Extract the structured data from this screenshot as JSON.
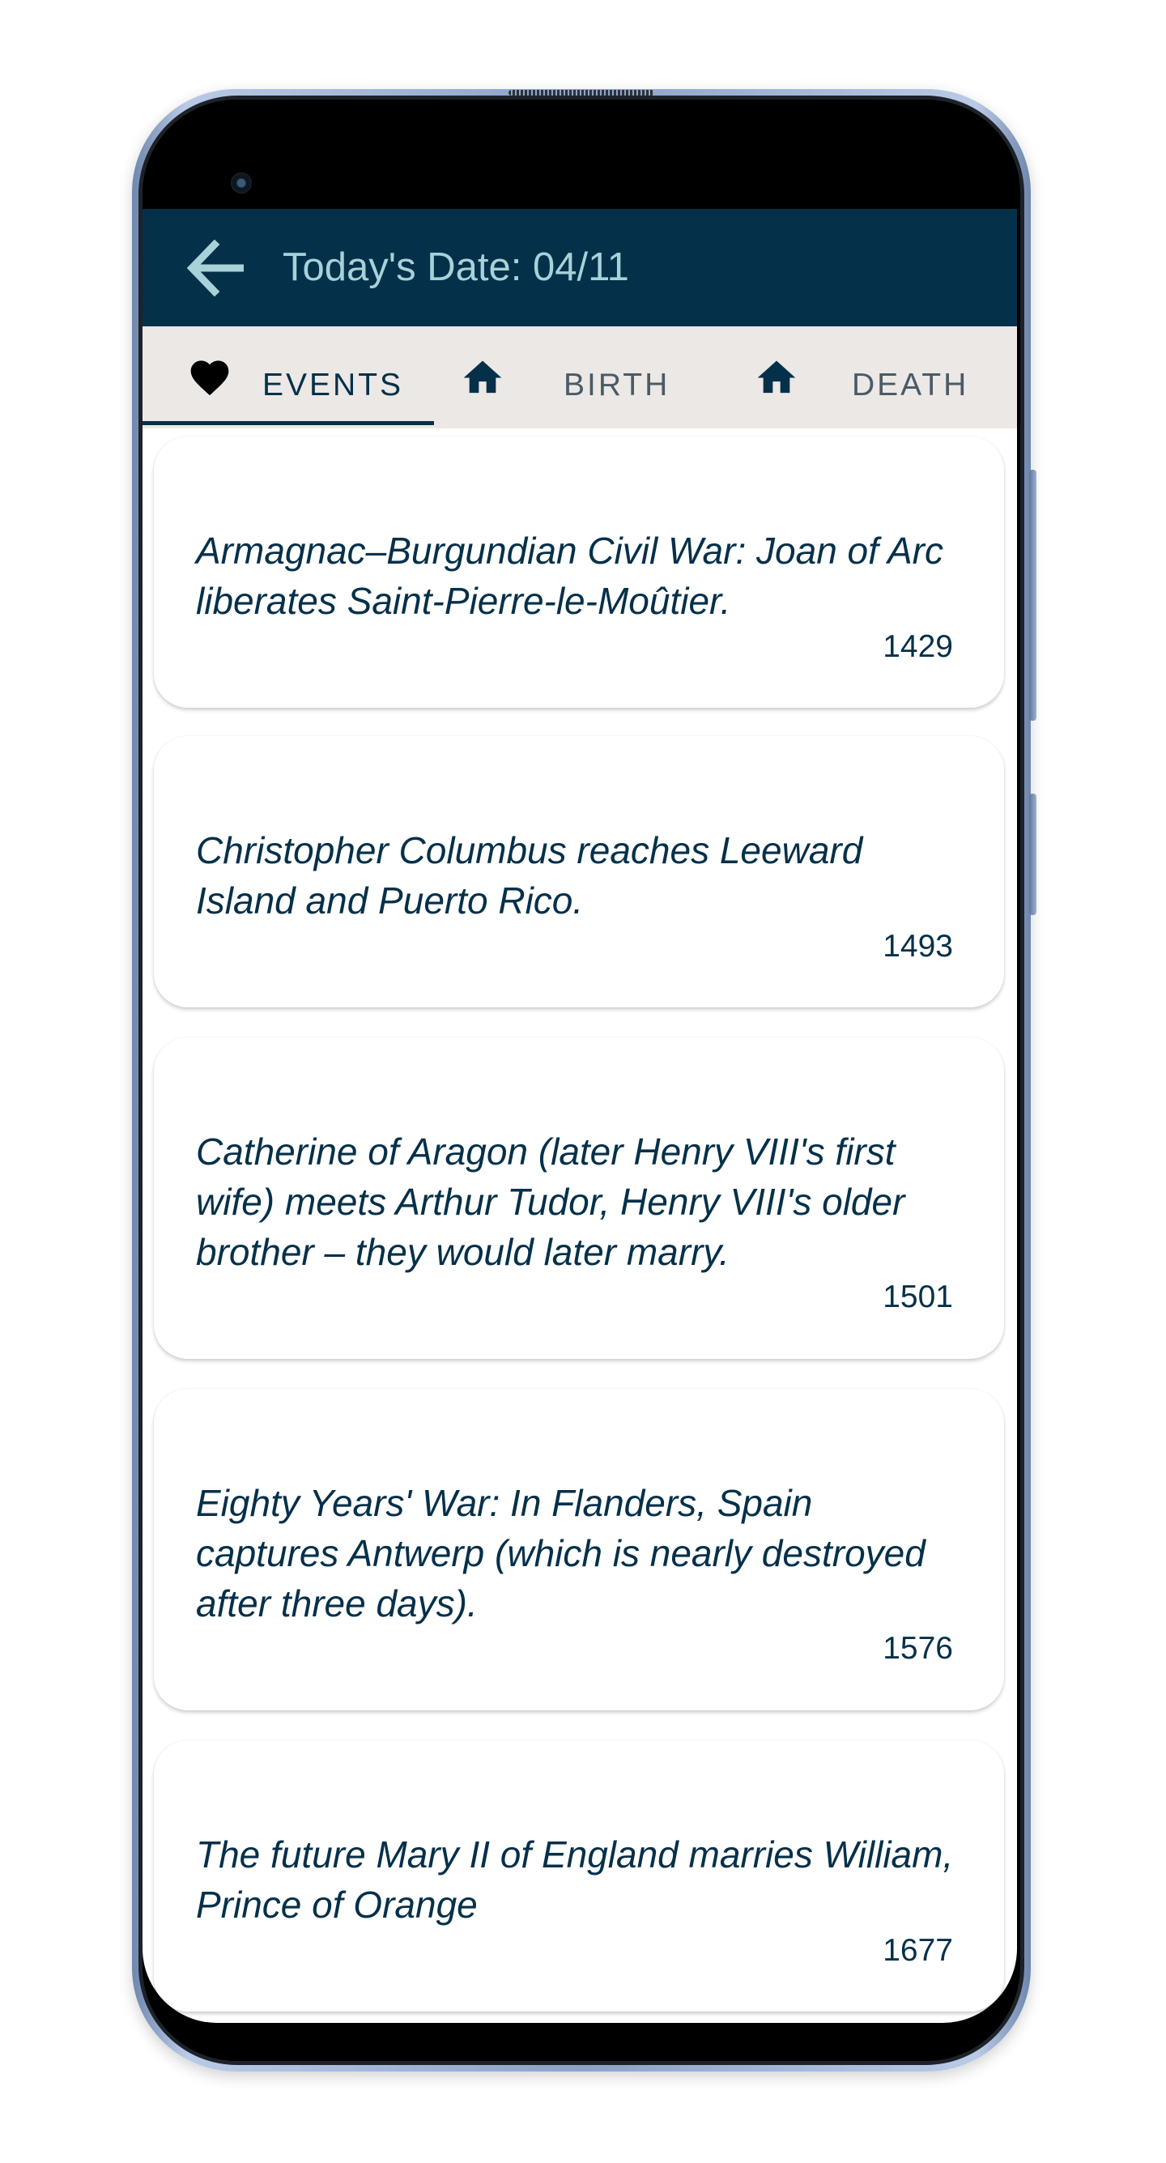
{
  "app_bar": {
    "back_icon": "arrow-left-icon",
    "title": "Today's Date: 04/11"
  },
  "tabs": [
    {
      "label": "EVENTS",
      "icon": "heart-icon",
      "active": true
    },
    {
      "label": "BIRTH",
      "icon": "home-icon",
      "active": false
    },
    {
      "label": "DEATH",
      "icon": "home-icon",
      "active": false
    }
  ],
  "events": [
    {
      "text": "Armagnac–Burgundian Civil War: Joan of Arc liberates Saint-Pierre-le-Moûtier.",
      "year": "1429"
    },
    {
      "text": "Christopher Columbus reaches Leeward Island and Puerto Rico.",
      "year": "1493"
    },
    {
      "text": "Catherine of Aragon (later Henry VIII's first wife) meets Arthur Tudor, Henry VIII's older brother – they would later marry.",
      "year": "1501"
    },
    {
      "text": "Eighty Years' War: In Flanders, Spain captures Antwerp (which is nearly destroyed after three days).",
      "year": "1576"
    },
    {
      "text": "The future Mary II of England marries William, Prince of Orange",
      "year": "1677"
    }
  ],
  "colors": {
    "app_bar": "#05304a",
    "title_text": "#a6d2d8",
    "tab_bar": "#ece8e5",
    "card_text": "#05304a"
  }
}
